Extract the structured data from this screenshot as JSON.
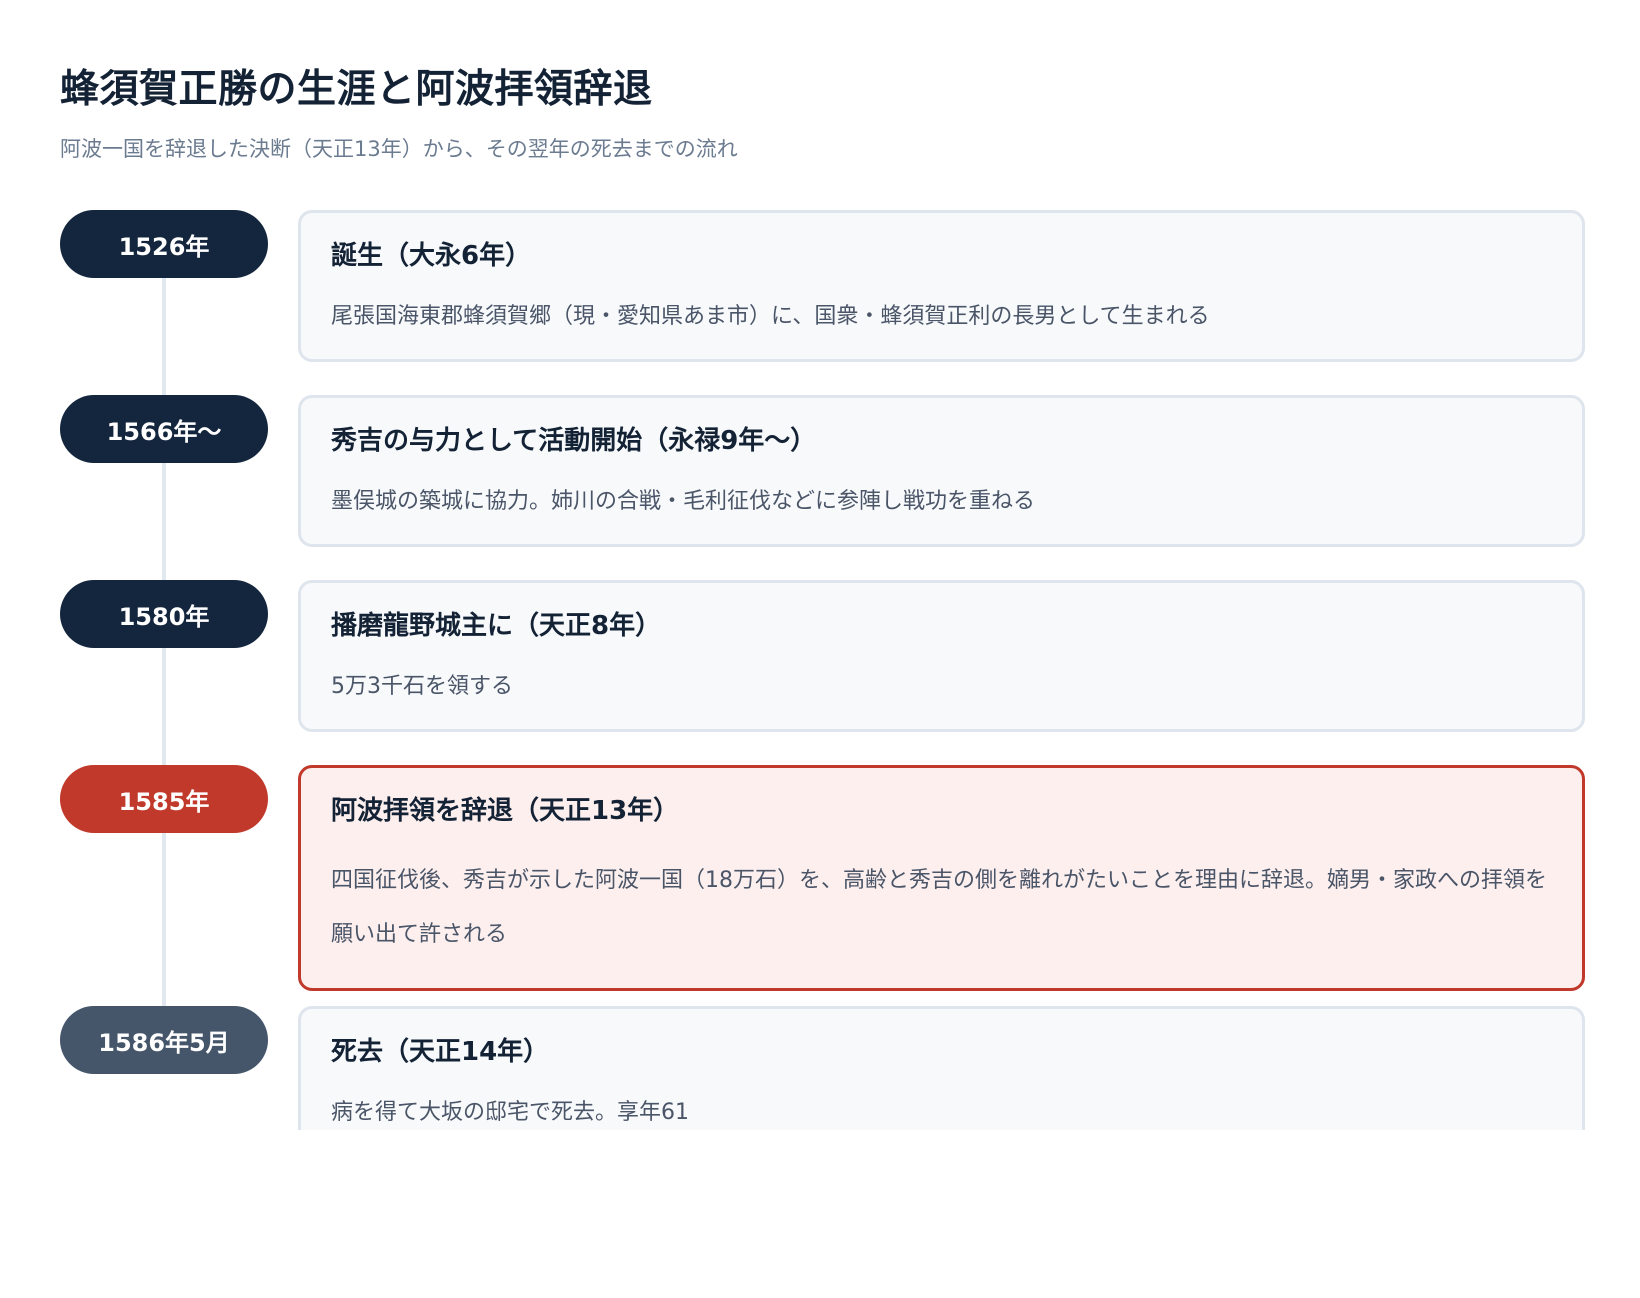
{
  "title": "蜂須賀正勝の生涯と阿波拝領辞退",
  "subtitle": "阿波一国を辞退した決断（天正13年）から、その翌年の死去までの流れ",
  "events": [
    {
      "year": "1526年",
      "title": "誕生（大永6年）",
      "description": "尾張国海東郡蜂須賀郷（現・愛知県あま市）に、国衆・蜂須賀正利の長男として生まれる"
    },
    {
      "year": "1566年〜",
      "title": "秀吉の与力として活動開始（永禄9年〜）",
      "description": "墨俣城の築城に協力。姉川の合戦・毛利征伐などに参陣し戦功を重ねる"
    },
    {
      "year": "1580年",
      "title": "播磨龍野城主に（天正8年）",
      "description": "5万3千石を領する"
    },
    {
      "year": "1585年",
      "title": "阿波拝領を辞退（天正13年）",
      "description": "四国征伐後、秀吉が示した阿波一国（18万石）を、高齢と秀吉の側を離れがたいことを理由に辞退。嫡男・家政への拝領を願い出て許される"
    },
    {
      "year": "1586年5月",
      "title": "死去（天正14年）",
      "description": "病を得て大坂の邸宅で死去。享年61"
    }
  ],
  "colors": {
    "pill_default": "#14263d",
    "pill_highlight": "#c0392b",
    "pill_final": "#45556a",
    "card_highlight_border": "#c0392b",
    "card_highlight_bg": "#fcefee"
  }
}
